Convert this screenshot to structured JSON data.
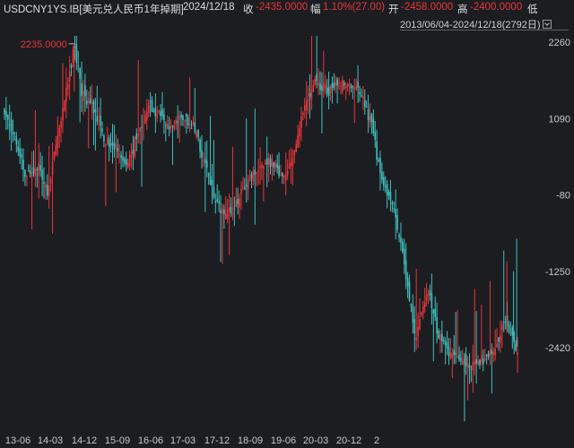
{
  "header": {
    "symbol": "USDCNY1YS.IB[美元兑人民币1年掉期]",
    "date": "2024/12/18",
    "close_label": "收",
    "close_value": "-2435.0000",
    "change_label": "幅",
    "change_value": "1.10%(27.00)",
    "open_label": "开",
    "open_value": "-2458.0000",
    "high_label": "高",
    "high_value": "-2400.0000",
    "low_label": "低",
    "range": "2013/06/04-2024/12/18(2792日)"
  },
  "colors": {
    "up": "#e8363a",
    "down": "#3fc1bf",
    "background": "#1c1d21",
    "text": "#c8c8c8"
  },
  "chart_data": {
    "type": "candlestick",
    "ylim": [
      -3700,
      2800
    ],
    "yticks": [
      "2260",
      "1090",
      "-80",
      "-1250",
      "-2420"
    ],
    "xticks": [
      "13-06",
      "14-03",
      "14-12",
      "15-09",
      "16-06",
      "17-03",
      "17-12",
      "18-09",
      "19-06",
      "20-03",
      "20-12",
      "2"
    ],
    "max_annotation": "2235.0000",
    "series_points": [
      [
        "2013-06",
        1200
      ],
      [
        "2013-09",
        800
      ],
      [
        "2013-12",
        180
      ],
      [
        "2014-03",
        400
      ],
      [
        "2014-06",
        -60
      ],
      [
        "2014-09",
        1000
      ],
      [
        "2014-12",
        1800
      ],
      [
        "2015-01",
        2200
      ],
      [
        "2015-03",
        1500
      ],
      [
        "2015-06",
        1250
      ],
      [
        "2015-09",
        800
      ],
      [
        "2015-12",
        650
      ],
      [
        "2016-03",
        350
      ],
      [
        "2016-06",
        800
      ],
      [
        "2016-09",
        1300
      ],
      [
        "2016-12",
        1150
      ],
      [
        "2017-03",
        950
      ],
      [
        "2017-06",
        1050
      ],
      [
        "2017-09",
        1000
      ],
      [
        "2017-12",
        420
      ],
      [
        "2018-03",
        -150
      ],
      [
        "2018-06",
        -400
      ],
      [
        "2018-09",
        -150
      ],
      [
        "2018-12",
        200
      ],
      [
        "2019-03",
        300
      ],
      [
        "2019-06",
        420
      ],
      [
        "2019-09",
        200
      ],
      [
        "2019-12",
        500
      ],
      [
        "2020-03",
        1300
      ],
      [
        "2020-06",
        1700
      ],
      [
        "2020-09",
        1500
      ],
      [
        "2020-12",
        1650
      ],
      [
        "2021-03",
        1600
      ],
      [
        "2021-06",
        1500
      ],
      [
        "2021-09",
        1000
      ],
      [
        "2021-12",
        80
      ],
      [
        "2022-03",
        -300
      ],
      [
        "2022-06",
        -1250
      ],
      [
        "2022-09",
        -2300
      ],
      [
        "2022-12",
        -1500
      ],
      [
        "2023-03",
        -2200
      ],
      [
        "2023-06",
        -2500
      ],
      [
        "2023-09",
        -2600
      ],
      [
        "2023-12",
        -2750
      ],
      [
        "2024-03",
        -2600
      ],
      [
        "2024-06",
        -2400
      ],
      [
        "2024-09",
        -2000
      ],
      [
        "2024-12",
        -2435
      ]
    ]
  }
}
